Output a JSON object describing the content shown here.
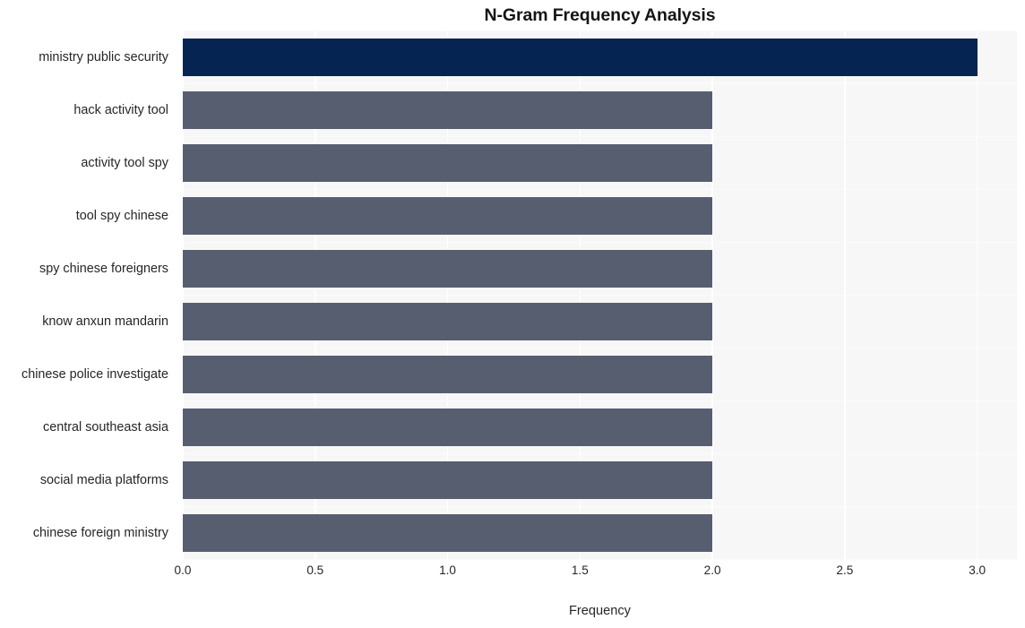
{
  "chart_data": {
    "type": "bar",
    "orientation": "horizontal",
    "title": "N-Gram Frequency Analysis",
    "xlabel": "Frequency",
    "ylabel": "",
    "categories": [
      "ministry public security",
      "hack activity tool",
      "activity tool spy",
      "tool spy chinese",
      "spy chinese foreigners",
      "know anxun mandarin",
      "chinese police investigate",
      "central southeast asia",
      "social media platforms",
      "chinese foreign ministry"
    ],
    "values": [
      3,
      2,
      2,
      2,
      2,
      2,
      2,
      2,
      2,
      2
    ],
    "bar_colors": [
      "#052451",
      "#575e70",
      "#575e70",
      "#575e70",
      "#575e70",
      "#575e70",
      "#575e70",
      "#575e70",
      "#575e70",
      "#575e70"
    ],
    "xlim": [
      0,
      3.15
    ],
    "xticks": [
      0,
      0.5,
      1,
      1.5,
      2,
      2.5,
      3
    ],
    "xtick_labels": [
      "0.0",
      "0.5",
      "1.0",
      "1.5",
      "2.0",
      "2.5",
      "3.0"
    ],
    "grid": true,
    "grid_color": "#ffffff",
    "plot_background": "#f7f7f7",
    "figure_background": "#ffffff",
    "legend": null
  }
}
